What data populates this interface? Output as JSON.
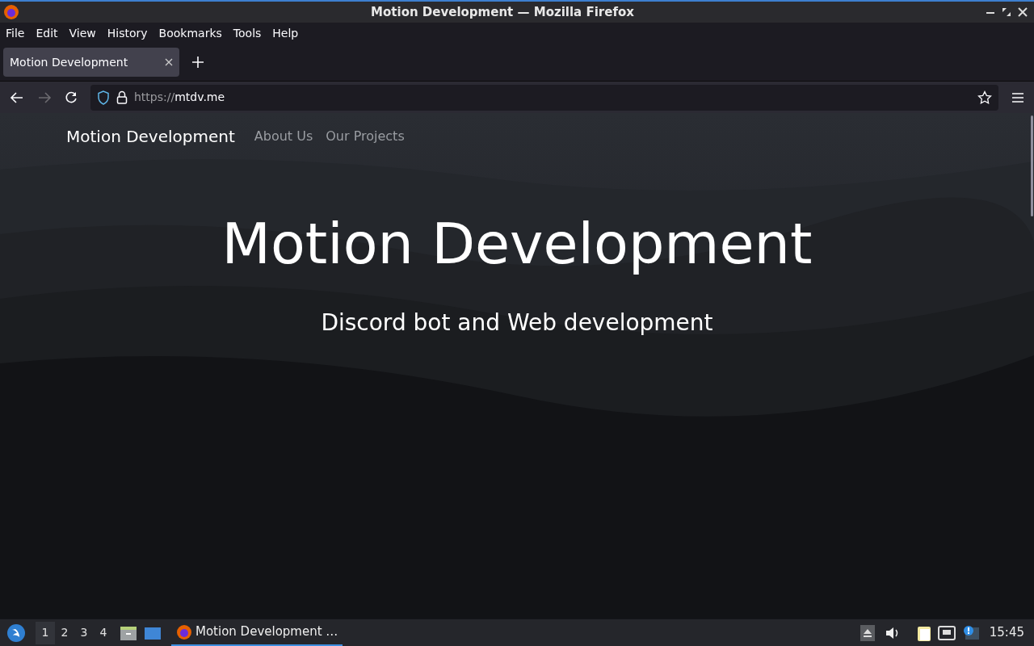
{
  "window": {
    "title": "Motion Development — Mozilla Firefox"
  },
  "menu": [
    "File",
    "Edit",
    "View",
    "History",
    "Bookmarks",
    "Tools",
    "Help"
  ],
  "tabs": [
    {
      "label": "Motion Development",
      "selected": true
    }
  ],
  "address": {
    "scheme": "https://",
    "host": "mtdv.me"
  },
  "site": {
    "brand": "Motion Development",
    "nav": [
      "About Us",
      "Our Projects"
    ],
    "heading": "Motion Development",
    "subheading": "Discord bot and Web development"
  },
  "taskbar": {
    "workspaces": [
      {
        "label": "1",
        "selected": true
      },
      {
        "label": "2",
        "selected": false
      },
      {
        "label": "3",
        "selected": false
      },
      {
        "label": "4",
        "selected": false
      }
    ],
    "task": "Motion Development …",
    "clock": "15:45"
  }
}
